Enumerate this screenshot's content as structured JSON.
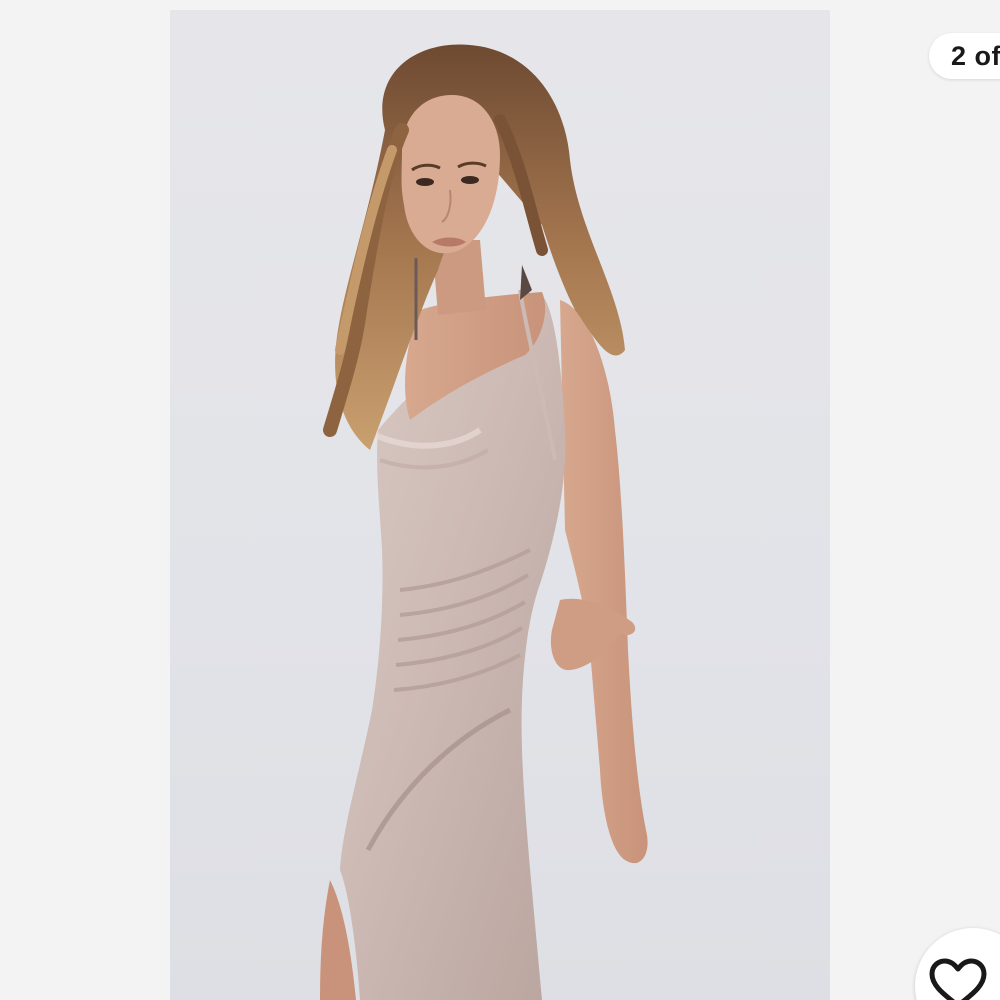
{
  "viewer": {
    "counter_label": "2 of",
    "favorite_icon": "heart-outline-icon",
    "accent_color": "#191919",
    "background_color": "#f3f3f3"
  }
}
